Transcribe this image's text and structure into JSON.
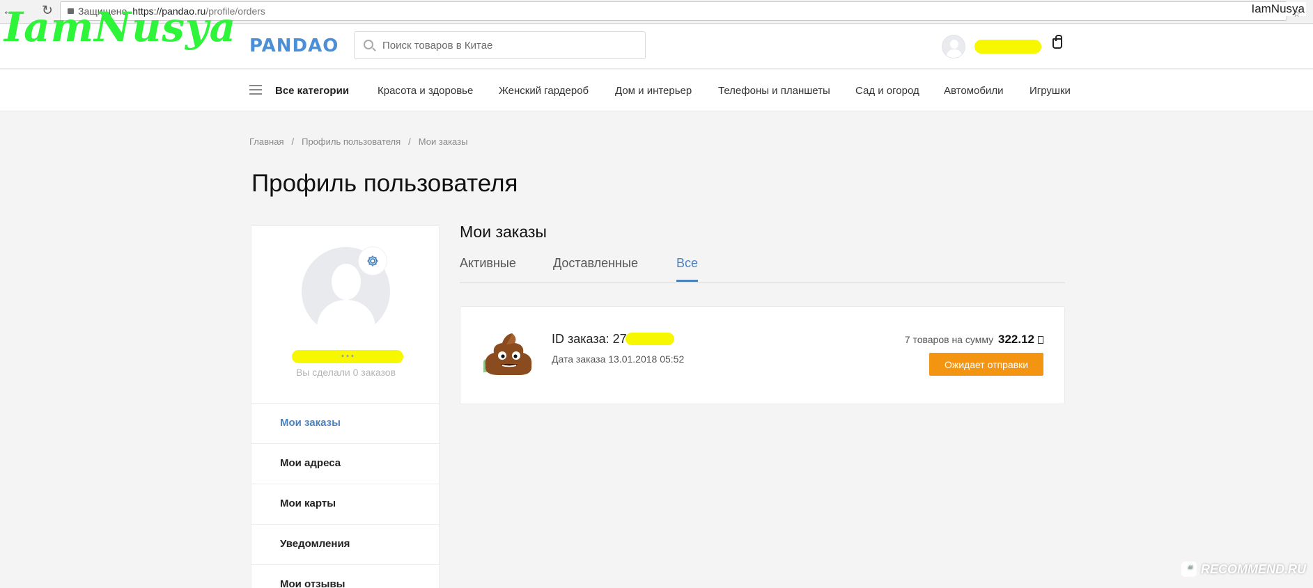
{
  "browser": {
    "secure_label": "Защищено",
    "url_host": "https://pandao.ru",
    "url_path": "/profile/orders",
    "user": "IamNusya"
  },
  "watermark": {
    "top": "IamNusya",
    "bottom": "RECOMMEND.RU"
  },
  "header": {
    "logo": "PANDAO",
    "search_placeholder": "Поиск товаров в Китае"
  },
  "categories": {
    "all": "Все категории",
    "items": [
      "Красота и здоровье",
      "Женский гардероб",
      "Дом и интерьер",
      "Телефоны и планшеты",
      "Сад и огород",
      "Автомобили",
      "Игрушки"
    ]
  },
  "breadcrumb": [
    "Главная",
    "Профиль пользователя",
    "Мои заказы"
  ],
  "page_title": "Профиль пользователя",
  "sidebar": {
    "orders_count_text": "Вы сделали 0 заказов",
    "menu": [
      "Мои заказы",
      "Мои адреса",
      "Мои карты",
      "Уведомления",
      "Мои отзывы"
    ]
  },
  "main": {
    "title": "Мои заказы",
    "tabs": [
      "Активные",
      "Доставленные",
      "Все"
    ],
    "active_tab": "Все",
    "order": {
      "id_label": "ID заказа: 27",
      "date": "Дата заказа 13.01.2018 05:52",
      "sum_prefix": "7 товаров на сумму",
      "sum_value": "322.12",
      "status": "Ожидает отправки"
    }
  },
  "colors": {
    "accent": "#4b82bd",
    "status": "#f49512",
    "redaction": "#f7f700",
    "watermark": "#2ff53a"
  }
}
